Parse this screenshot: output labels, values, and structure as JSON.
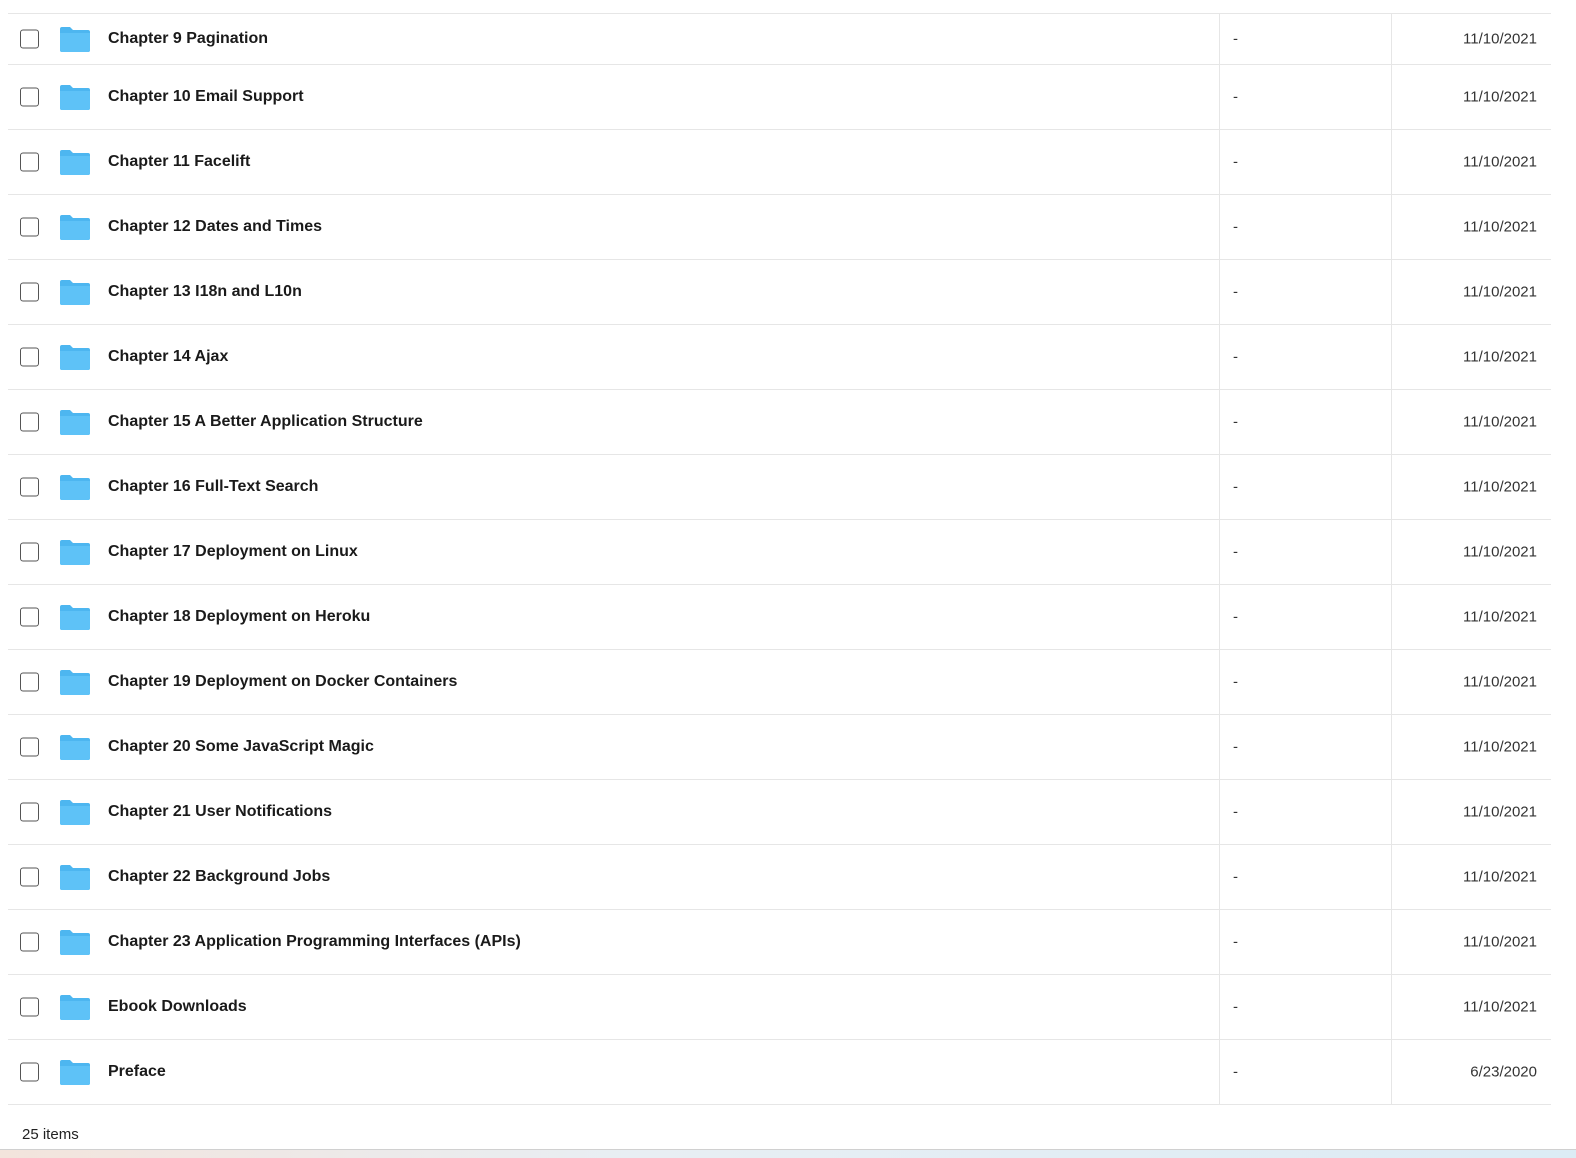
{
  "rows": [
    {
      "name": "Chapter 9 Pagination",
      "size": "-",
      "date": "11/10/2021"
    },
    {
      "name": "Chapter 10 Email Support",
      "size": "-",
      "date": "11/10/2021"
    },
    {
      "name": "Chapter 11 Facelift",
      "size": "-",
      "date": "11/10/2021"
    },
    {
      "name": "Chapter 12 Dates and Times",
      "size": "-",
      "date": "11/10/2021"
    },
    {
      "name": "Chapter 13 I18n and L10n",
      "size": "-",
      "date": "11/10/2021"
    },
    {
      "name": "Chapter 14 Ajax",
      "size": "-",
      "date": "11/10/2021"
    },
    {
      "name": "Chapter 15 A Better Application Structure",
      "size": "-",
      "date": "11/10/2021"
    },
    {
      "name": "Chapter 16 Full-Text Search",
      "size": "-",
      "date": "11/10/2021"
    },
    {
      "name": "Chapter 17 Deployment on Linux",
      "size": "-",
      "date": "11/10/2021"
    },
    {
      "name": "Chapter 18 Deployment on Heroku",
      "size": "-",
      "date": "11/10/2021"
    },
    {
      "name": "Chapter 19 Deployment on Docker Containers",
      "size": "-",
      "date": "11/10/2021"
    },
    {
      "name": "Chapter 20 Some JavaScript Magic",
      "size": "-",
      "date": "11/10/2021"
    },
    {
      "name": "Chapter 21 User Notifications",
      "size": "-",
      "date": "11/10/2021"
    },
    {
      "name": "Chapter 22 Background Jobs",
      "size": "-",
      "date": "11/10/2021"
    },
    {
      "name": "Chapter 23 Application Programming Interfaces (APIs)",
      "size": "-",
      "date": "11/10/2021"
    },
    {
      "name": "Ebook Downloads",
      "size": "-",
      "date": "11/10/2021"
    },
    {
      "name": "Preface",
      "size": "-",
      "date": "6/23/2020"
    }
  ],
  "status": {
    "item_count": "25 items"
  },
  "colors": {
    "folder": "#5ec2f7",
    "folder_tab": "#4db6f0"
  },
  "icons": {
    "row_icon": "folder-icon"
  }
}
